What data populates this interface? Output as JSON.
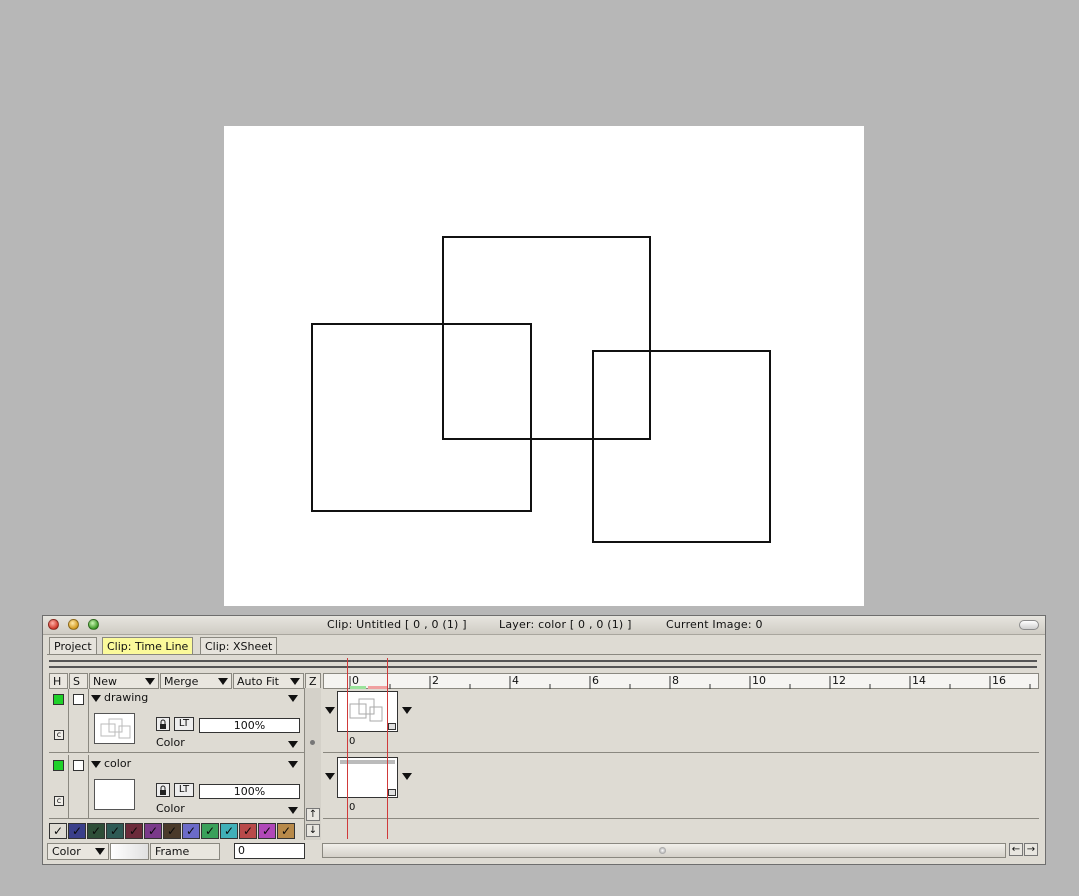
{
  "canvas": {
    "shapes": [
      "square-left",
      "square-top",
      "square-right"
    ]
  },
  "window": {
    "title_clip": "Clip: Untitled [ 0 , 0  (1) ]",
    "title_layer": "Layer: color [ 0 , 0  (1) ]",
    "title_image": "Current Image: 0"
  },
  "tabs": [
    {
      "label": "Project",
      "active": false
    },
    {
      "label": "Clip: Time Line",
      "active": true
    },
    {
      "label": "Clip: XSheet",
      "active": false
    }
  ],
  "header": {
    "h": "H",
    "s": "S",
    "new": "New",
    "merge": "Merge",
    "autofit": "Auto Fit",
    "z": "Z"
  },
  "layers": [
    {
      "name": "drawing",
      "opacity": "100%",
      "mode": "Color",
      "c": "c",
      "lt": "LT",
      "frame": "0"
    },
    {
      "name": "color",
      "opacity": "100%",
      "mode": "Color",
      "c": "c",
      "lt": "LT",
      "frame": "0"
    }
  ],
  "ruler": {
    "labels": [
      "0",
      "2",
      "4",
      "6",
      "8",
      "10",
      "12",
      "14",
      "16"
    ]
  },
  "swatches": [
    {
      "color": "#dedbd3"
    },
    {
      "color": "#3a3f8a"
    },
    {
      "color": "#2e4e38"
    },
    {
      "color": "#2e5a55"
    },
    {
      "color": "#6b2a3a"
    },
    {
      "color": "#7a3a8a"
    },
    {
      "color": "#4a3a2a"
    },
    {
      "color": "#6b6bc8"
    },
    {
      "color": "#3aa05a"
    },
    {
      "color": "#40b0b8"
    },
    {
      "color": "#b84a4a"
    },
    {
      "color": "#b048b8"
    },
    {
      "color": "#b88a4a"
    }
  ],
  "bottom": {
    "mode": "Color",
    "frame_label": "Frame",
    "frame_value": "0"
  },
  "colors": {
    "active_tab": "#fbfa9b",
    "hide_on": "#1fd12a",
    "playhead": "#d03a3a"
  }
}
